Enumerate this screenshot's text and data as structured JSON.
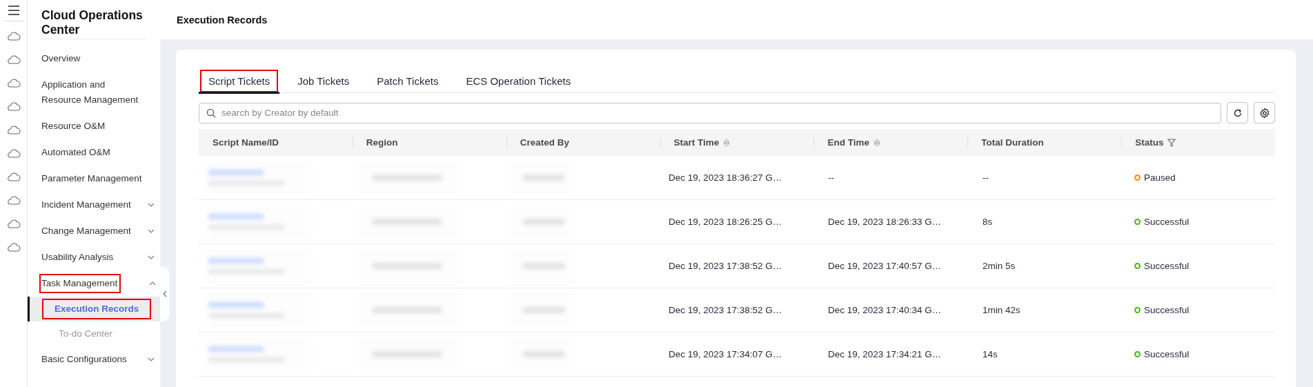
{
  "sidebar": {
    "title": "Cloud Operations Center",
    "items": [
      {
        "label": "Overview",
        "kind": "link",
        "highlighted": false
      },
      {
        "label": "Application and Resource Management",
        "kind": "link",
        "highlighted": false
      },
      {
        "label": "Resource O&M",
        "kind": "link",
        "highlighted": false
      },
      {
        "label": "Automated O&M",
        "kind": "link",
        "highlighted": false
      },
      {
        "label": "Parameter Management",
        "kind": "link",
        "highlighted": false
      },
      {
        "label": "Incident Management",
        "kind": "group",
        "expanded": false,
        "highlighted": false
      },
      {
        "label": "Change Management",
        "kind": "group",
        "expanded": false,
        "highlighted": false
      },
      {
        "label": "Usability Analysis",
        "kind": "group",
        "expanded": false,
        "highlighted": false
      },
      {
        "label": "Task Management",
        "kind": "group",
        "expanded": true,
        "highlighted": true,
        "children": [
          {
            "label": "Execution Records",
            "selected": true,
            "highlighted": true
          },
          {
            "label": "To-do Center",
            "selected": false,
            "highlighted": false
          }
        ]
      },
      {
        "label": "Basic Configurations",
        "kind": "group",
        "expanded": false,
        "highlighted": false
      }
    ]
  },
  "header": {
    "title": "Execution Records"
  },
  "tabs": [
    {
      "label": "Script Tickets",
      "selected": true,
      "highlighted": true
    },
    {
      "label": "Job Tickets",
      "selected": false,
      "highlighted": false
    },
    {
      "label": "Patch Tickets",
      "selected": false,
      "highlighted": false
    },
    {
      "label": "ECS Operation Tickets",
      "selected": false,
      "highlighted": false
    }
  ],
  "search": {
    "placeholder": "search by Creator by default"
  },
  "table": {
    "columns": [
      {
        "label": "Script Name/ID",
        "sort": false,
        "filter": false
      },
      {
        "label": "Region",
        "sort": false,
        "filter": false
      },
      {
        "label": "Created By",
        "sort": false,
        "filter": false
      },
      {
        "label": "Start Time",
        "sort": true,
        "filter": false
      },
      {
        "label": "End Time",
        "sort": true,
        "filter": false
      },
      {
        "label": "Total Duration",
        "sort": false,
        "filter": false
      },
      {
        "label": "Status",
        "sort": false,
        "filter": true
      }
    ],
    "rows": [
      {
        "start_time": "Dec 19, 2023 18:36:27 G…",
        "end_time": "--",
        "duration": "--",
        "status": {
          "label": "Paused",
          "color": "#ff8a00"
        }
      },
      {
        "start_time": "Dec 19, 2023 18:26:25 G…",
        "end_time": "Dec 19, 2023 18:26:33 G…",
        "duration": "8s",
        "status": {
          "label": "Successful",
          "color": "#4fb31b"
        }
      },
      {
        "start_time": "Dec 19, 2023 17:38:52 G…",
        "end_time": "Dec 19, 2023 17:40:57 G…",
        "duration": "2min 5s",
        "status": {
          "label": "Successful",
          "color": "#4fb31b"
        }
      },
      {
        "start_time": "Dec 19, 2023 17:38:52 G…",
        "end_time": "Dec 19, 2023 17:40:34 G…",
        "duration": "1min 42s",
        "status": {
          "label": "Successful",
          "color": "#4fb31b"
        }
      },
      {
        "start_time": "Dec 19, 2023 17:34:07 G…",
        "end_time": "Dec 19, 2023 17:34:21 G…",
        "duration": "14s",
        "status": {
          "label": "Successful",
          "color": "#4fb31b"
        }
      }
    ]
  }
}
